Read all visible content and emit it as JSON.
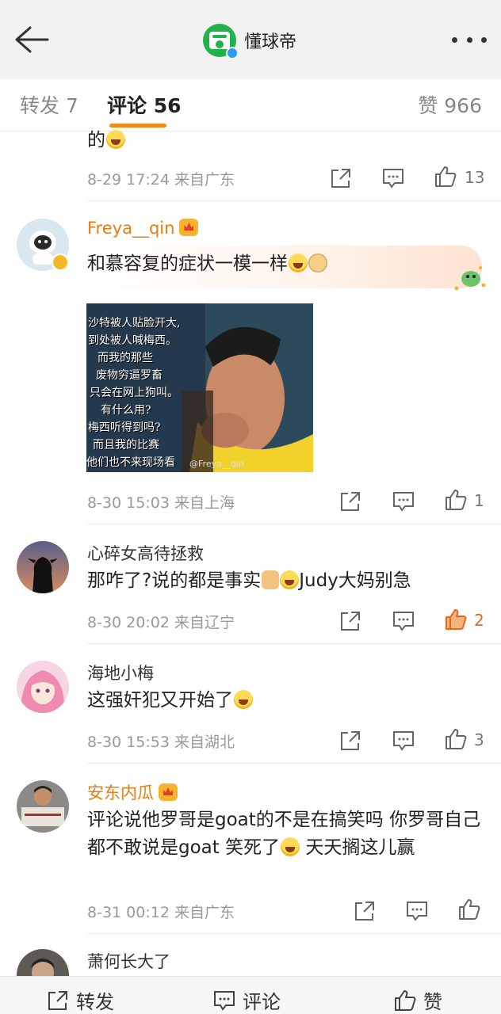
{
  "header": {
    "title": "懂球帝",
    "back_icon": "arrow-left-icon",
    "more_icon": "more-dots-icon"
  },
  "tabs": {
    "repost": "转发 7",
    "comment": "评论 56",
    "like": "赞 966"
  },
  "comments": [
    {
      "text_tail": "的",
      "time": "8-29 17:24",
      "location": "来自广东",
      "likes": "13"
    },
    {
      "username": "Freya__qin",
      "text": "和慕容复的症状一模一样",
      "image_caption": [
        "沙特被人贴脸开大,",
        "到处被人喊梅西。",
        "而我的那些",
        "废物穷逼罗畜",
        "只会在网上狗叫。",
        "有什么用?",
        "梅西听得到吗?",
        "而且我的比赛",
        "他们也不来现场看"
      ],
      "image_watermark": "@Freya__qin",
      "time": "8-30 15:03",
      "location": "来自上海",
      "likes": "1"
    },
    {
      "username": "心碎女高待拯救",
      "text_a": "那咋了?说的都是事实",
      "text_b": "Judy大妈别急",
      "time": "8-30 20:02",
      "location": "来自辽宁",
      "likes": "2"
    },
    {
      "username": "海地小梅",
      "text": "这强奸犯又开始了",
      "time": "8-30 15:53",
      "location": "来自湖北",
      "likes": "3"
    },
    {
      "username": "安东内瓜",
      "text_a": "评论说他罗哥是goat的不是在搞笑吗 你罗哥自己都不敢说是goat 笑死了",
      "text_b": " 天天搁这儿赢",
      "time": "8-31 00:12",
      "location": "来自广东"
    },
    {
      "username": "萧何长大了"
    }
  ],
  "bottombar": {
    "repost": "转发",
    "comment": "评论",
    "like": "赞"
  },
  "colors": {
    "accent": "#f08c1c",
    "liked": "#e8671f",
    "vip_name": "#e87c15",
    "verified": "#2c9cf0",
    "brand": "#21b24b"
  }
}
